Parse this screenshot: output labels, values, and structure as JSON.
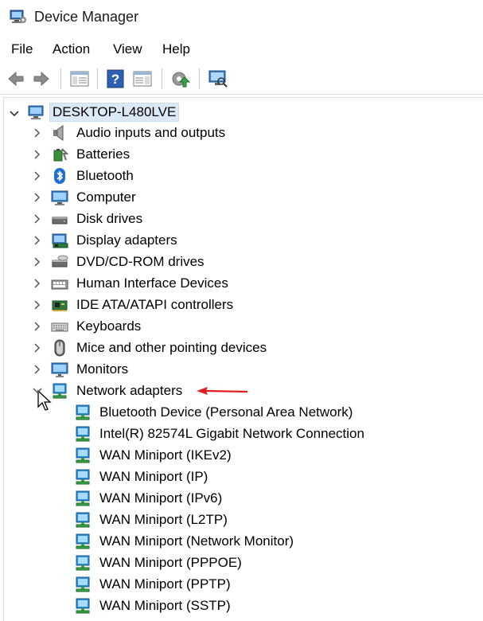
{
  "window": {
    "title": "Device Manager"
  },
  "menu": [
    "File",
    "Action",
    "View",
    "Help"
  ],
  "toolbar_icons": [
    "back-icon",
    "forward-icon",
    "show-hide-console-tree-icon",
    "help-icon",
    "properties-icon",
    "update-driver-icon",
    "scan-hardware-icon"
  ],
  "tree": {
    "root": "DESKTOP-L480LVE",
    "categories": [
      {
        "label": "Audio inputs and outputs",
        "icon": "speaker-icon"
      },
      {
        "label": "Batteries",
        "icon": "battery-icon"
      },
      {
        "label": "Bluetooth",
        "icon": "bluetooth-icon"
      },
      {
        "label": "Computer",
        "icon": "computer-icon"
      },
      {
        "label": "Disk drives",
        "icon": "disk-drive-icon"
      },
      {
        "label": "Display adapters",
        "icon": "display-adapter-icon"
      },
      {
        "label": "DVD/CD-ROM drives",
        "icon": "dvd-drive-icon"
      },
      {
        "label": "Human Interface Devices",
        "icon": "hid-icon"
      },
      {
        "label": "IDE ATA/ATAPI controllers",
        "icon": "ide-controller-icon"
      },
      {
        "label": "Keyboards",
        "icon": "keyboard-icon"
      },
      {
        "label": "Mice and other pointing devices",
        "icon": "mouse-icon"
      },
      {
        "label": "Monitors",
        "icon": "monitor-icon"
      },
      {
        "label": "Network adapters",
        "icon": "network-adapter-icon"
      }
    ],
    "network_adapters": [
      "Bluetooth Device (Personal Area Network)",
      "Intel(R) 82574L Gigabit Network Connection",
      "WAN Miniport (IKEv2)",
      "WAN Miniport (IP)",
      "WAN Miniport (IPv6)",
      "WAN Miniport (L2TP)",
      "WAN Miniport (Network Monitor)",
      "WAN Miniport (PPPOE)",
      "WAN Miniport (PPTP)",
      "WAN Miniport (SSTP)"
    ]
  },
  "colors": {
    "selection": "#dbe9f7",
    "annotation_arrow": "#e02020",
    "network_icon": "#2e8fd8"
  }
}
